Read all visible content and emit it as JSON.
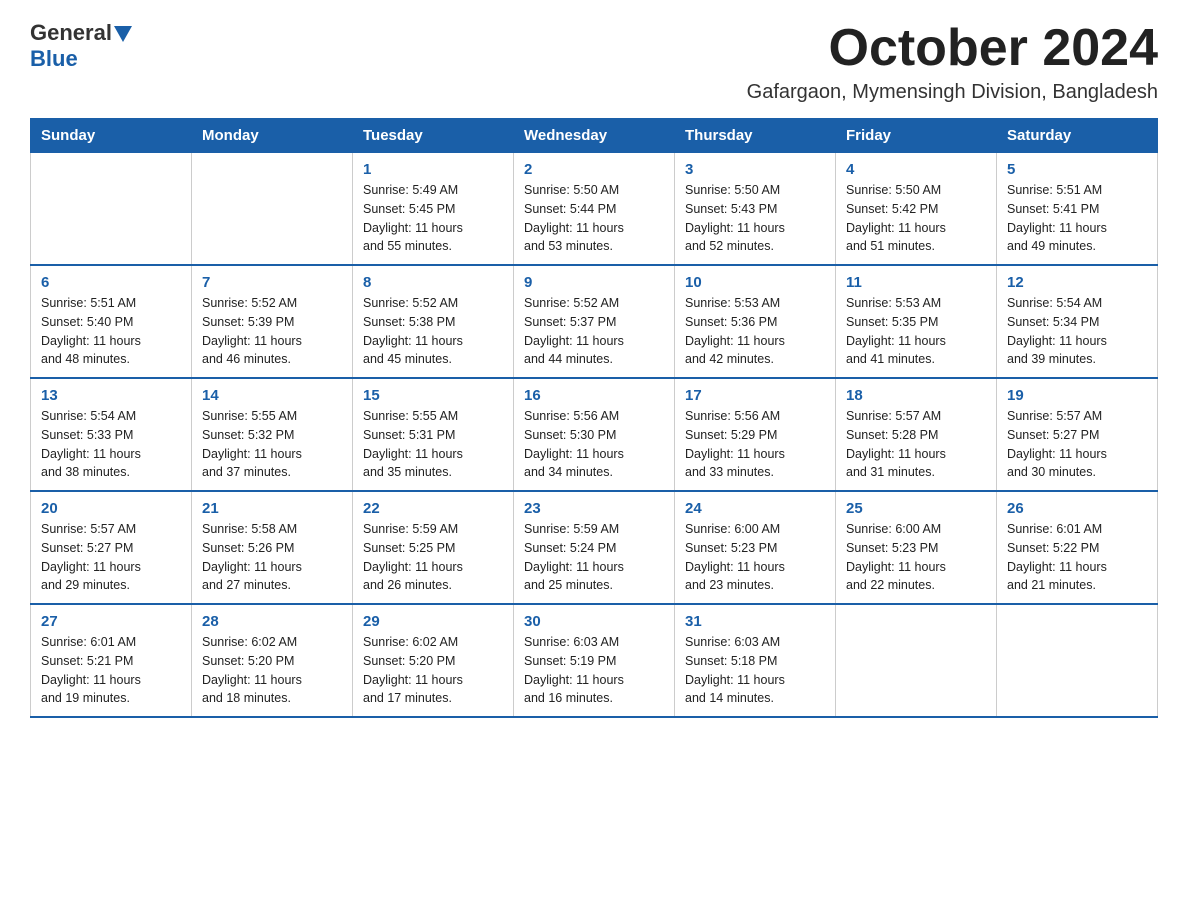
{
  "logo": {
    "text_general": "General",
    "text_blue": "Blue",
    "line2": "Blue"
  },
  "header": {
    "month_title": "October 2024",
    "location": "Gafargaon, Mymensingh Division, Bangladesh"
  },
  "weekdays": [
    "Sunday",
    "Monday",
    "Tuesday",
    "Wednesday",
    "Thursday",
    "Friday",
    "Saturday"
  ],
  "weeks": [
    [
      {
        "day": "",
        "info": ""
      },
      {
        "day": "",
        "info": ""
      },
      {
        "day": "1",
        "info": "Sunrise: 5:49 AM\nSunset: 5:45 PM\nDaylight: 11 hours\nand 55 minutes."
      },
      {
        "day": "2",
        "info": "Sunrise: 5:50 AM\nSunset: 5:44 PM\nDaylight: 11 hours\nand 53 minutes."
      },
      {
        "day": "3",
        "info": "Sunrise: 5:50 AM\nSunset: 5:43 PM\nDaylight: 11 hours\nand 52 minutes."
      },
      {
        "day": "4",
        "info": "Sunrise: 5:50 AM\nSunset: 5:42 PM\nDaylight: 11 hours\nand 51 minutes."
      },
      {
        "day": "5",
        "info": "Sunrise: 5:51 AM\nSunset: 5:41 PM\nDaylight: 11 hours\nand 49 minutes."
      }
    ],
    [
      {
        "day": "6",
        "info": "Sunrise: 5:51 AM\nSunset: 5:40 PM\nDaylight: 11 hours\nand 48 minutes."
      },
      {
        "day": "7",
        "info": "Sunrise: 5:52 AM\nSunset: 5:39 PM\nDaylight: 11 hours\nand 46 minutes."
      },
      {
        "day": "8",
        "info": "Sunrise: 5:52 AM\nSunset: 5:38 PM\nDaylight: 11 hours\nand 45 minutes."
      },
      {
        "day": "9",
        "info": "Sunrise: 5:52 AM\nSunset: 5:37 PM\nDaylight: 11 hours\nand 44 minutes."
      },
      {
        "day": "10",
        "info": "Sunrise: 5:53 AM\nSunset: 5:36 PM\nDaylight: 11 hours\nand 42 minutes."
      },
      {
        "day": "11",
        "info": "Sunrise: 5:53 AM\nSunset: 5:35 PM\nDaylight: 11 hours\nand 41 minutes."
      },
      {
        "day": "12",
        "info": "Sunrise: 5:54 AM\nSunset: 5:34 PM\nDaylight: 11 hours\nand 39 minutes."
      }
    ],
    [
      {
        "day": "13",
        "info": "Sunrise: 5:54 AM\nSunset: 5:33 PM\nDaylight: 11 hours\nand 38 minutes."
      },
      {
        "day": "14",
        "info": "Sunrise: 5:55 AM\nSunset: 5:32 PM\nDaylight: 11 hours\nand 37 minutes."
      },
      {
        "day": "15",
        "info": "Sunrise: 5:55 AM\nSunset: 5:31 PM\nDaylight: 11 hours\nand 35 minutes."
      },
      {
        "day": "16",
        "info": "Sunrise: 5:56 AM\nSunset: 5:30 PM\nDaylight: 11 hours\nand 34 minutes."
      },
      {
        "day": "17",
        "info": "Sunrise: 5:56 AM\nSunset: 5:29 PM\nDaylight: 11 hours\nand 33 minutes."
      },
      {
        "day": "18",
        "info": "Sunrise: 5:57 AM\nSunset: 5:28 PM\nDaylight: 11 hours\nand 31 minutes."
      },
      {
        "day": "19",
        "info": "Sunrise: 5:57 AM\nSunset: 5:27 PM\nDaylight: 11 hours\nand 30 minutes."
      }
    ],
    [
      {
        "day": "20",
        "info": "Sunrise: 5:57 AM\nSunset: 5:27 PM\nDaylight: 11 hours\nand 29 minutes."
      },
      {
        "day": "21",
        "info": "Sunrise: 5:58 AM\nSunset: 5:26 PM\nDaylight: 11 hours\nand 27 minutes."
      },
      {
        "day": "22",
        "info": "Sunrise: 5:59 AM\nSunset: 5:25 PM\nDaylight: 11 hours\nand 26 minutes."
      },
      {
        "day": "23",
        "info": "Sunrise: 5:59 AM\nSunset: 5:24 PM\nDaylight: 11 hours\nand 25 minutes."
      },
      {
        "day": "24",
        "info": "Sunrise: 6:00 AM\nSunset: 5:23 PM\nDaylight: 11 hours\nand 23 minutes."
      },
      {
        "day": "25",
        "info": "Sunrise: 6:00 AM\nSunset: 5:23 PM\nDaylight: 11 hours\nand 22 minutes."
      },
      {
        "day": "26",
        "info": "Sunrise: 6:01 AM\nSunset: 5:22 PM\nDaylight: 11 hours\nand 21 minutes."
      }
    ],
    [
      {
        "day": "27",
        "info": "Sunrise: 6:01 AM\nSunset: 5:21 PM\nDaylight: 11 hours\nand 19 minutes."
      },
      {
        "day": "28",
        "info": "Sunrise: 6:02 AM\nSunset: 5:20 PM\nDaylight: 11 hours\nand 18 minutes."
      },
      {
        "day": "29",
        "info": "Sunrise: 6:02 AM\nSunset: 5:20 PM\nDaylight: 11 hours\nand 17 minutes."
      },
      {
        "day": "30",
        "info": "Sunrise: 6:03 AM\nSunset: 5:19 PM\nDaylight: 11 hours\nand 16 minutes."
      },
      {
        "day": "31",
        "info": "Sunrise: 6:03 AM\nSunset: 5:18 PM\nDaylight: 11 hours\nand 14 minutes."
      },
      {
        "day": "",
        "info": ""
      },
      {
        "day": "",
        "info": ""
      }
    ]
  ]
}
